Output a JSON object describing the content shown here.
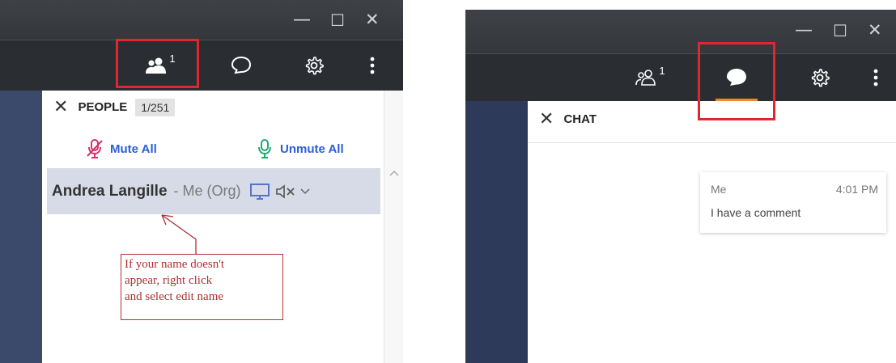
{
  "colors": {
    "titlebar": "#3a3d41",
    "toolbar": "#2a2d31",
    "accent_underline": "#f08a24",
    "highlight_box": "#e2262f",
    "mute_icon": "#d6336c",
    "unmute_icon": "#20a874",
    "action_text": "#2a5fd6",
    "selected_row": "#d6dbe7",
    "annotation": "#b03030"
  },
  "people_panel": {
    "window_controls": {
      "minimize": "—",
      "maximize": "☐",
      "close": "✕"
    },
    "toolbar": {
      "participants_count": "1",
      "active_tab": "participants-icon"
    },
    "header": {
      "title": "PEOPLE",
      "count": "1/251"
    },
    "actions": {
      "mute_all": "Mute All",
      "unmute_all": "Unmute All"
    },
    "participant": {
      "name": "Andrea Langille",
      "role": "- Me (Org)"
    },
    "annotation": {
      "line1": "If your name doesn't",
      "line2": "appear,  right click",
      "line3": "and select edit name"
    }
  },
  "chat_panel": {
    "window_controls": {
      "minimize": "—",
      "maximize": "☐",
      "close": "✕"
    },
    "toolbar": {
      "participants_count": "1",
      "active_tab": "chat-icon"
    },
    "header": {
      "title": "CHAT"
    },
    "message": {
      "sender": "Me",
      "time": "4:01 PM",
      "text": "I have a comment"
    }
  }
}
